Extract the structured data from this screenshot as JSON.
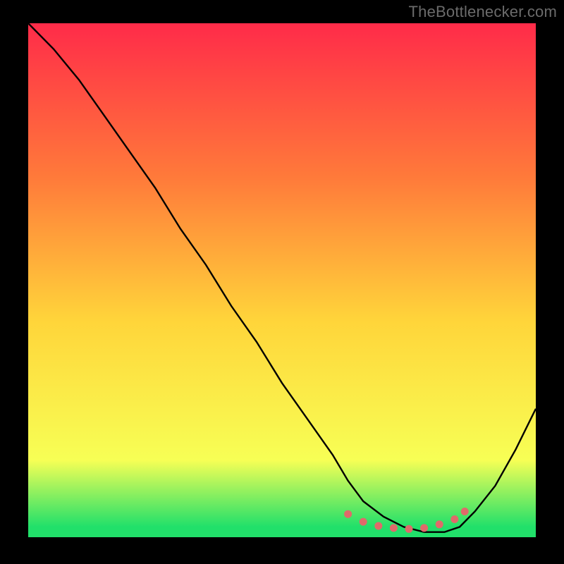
{
  "watermark": "TheBottlenecker.com",
  "chart_data": {
    "type": "line",
    "title": "",
    "xlabel": "",
    "ylabel": "",
    "xlim": [
      0,
      100
    ],
    "ylim": [
      0,
      100
    ],
    "grid": false,
    "background_gradient": {
      "top": "#ff2b49",
      "mid_upper": "#ff7a3a",
      "mid": "#ffd53a",
      "mid_lower": "#f7ff55",
      "bottom": "#21e06a"
    },
    "series": [
      {
        "name": "bottleneck-curve",
        "stroke": "#000000",
        "x": [
          0,
          5,
          10,
          15,
          20,
          25,
          30,
          35,
          40,
          45,
          50,
          55,
          60,
          63,
          66,
          70,
          74,
          78,
          82,
          85,
          88,
          92,
          96,
          100
        ],
        "y": [
          100,
          95,
          89,
          82,
          75,
          68,
          60,
          53,
          45,
          38,
          30,
          23,
          16,
          11,
          7,
          4,
          2,
          1,
          1,
          2,
          5,
          10,
          17,
          25
        ]
      }
    ],
    "markers": {
      "name": "optimal-range-dots",
      "color": "#e06a6a",
      "x": [
        63,
        66,
        69,
        72,
        75,
        78,
        81,
        84,
        86
      ],
      "y": [
        4.5,
        3.0,
        2.2,
        1.8,
        1.6,
        1.8,
        2.5,
        3.5,
        5.0
      ]
    }
  }
}
